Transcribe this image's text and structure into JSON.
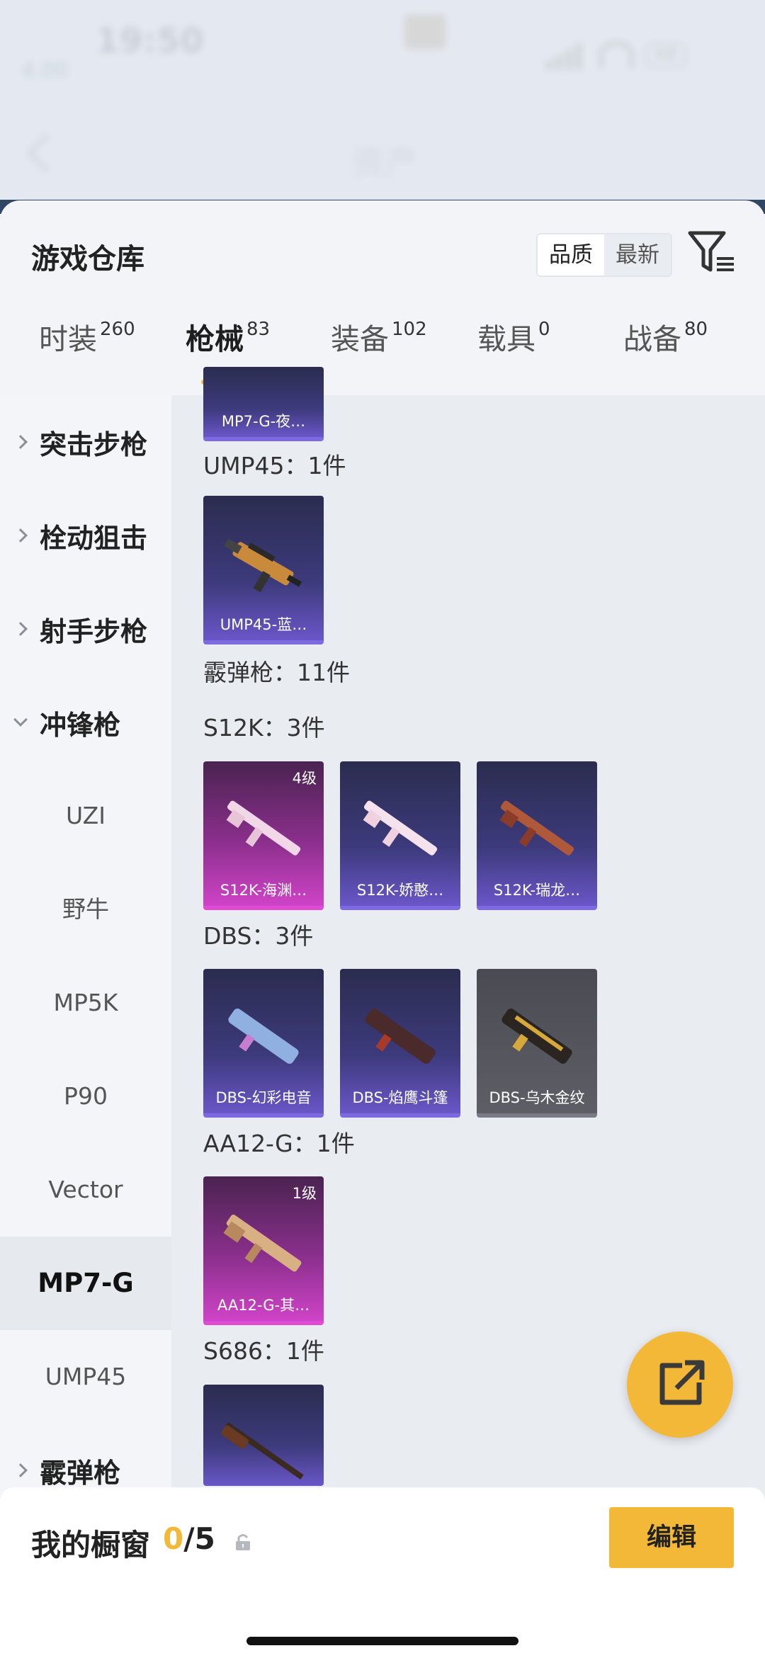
{
  "status": {
    "time": "19:50",
    "sub": "4.00",
    "battery": "68"
  },
  "header": {
    "title": "资产"
  },
  "panel": {
    "title": "游戏仓库",
    "sort": {
      "quality": "品质",
      "latest": "最新"
    }
  },
  "tabs": [
    {
      "label": "时装",
      "count": "260"
    },
    {
      "label": "枪械",
      "count": "83"
    },
    {
      "label": "装备",
      "count": "102"
    },
    {
      "label": "载具",
      "count": "0"
    },
    {
      "label": "战备",
      "count": "80"
    }
  ],
  "sidebar": {
    "categories": [
      "突击步枪",
      "栓动狙击",
      "射手步枪",
      "冲锋枪",
      "霰弹枪"
    ],
    "subs": [
      "UZI",
      "野牛",
      "MP5K",
      "P90",
      "Vector",
      "MP7-G",
      "UMP45"
    ]
  },
  "content": {
    "mp7_card": "MP7-G-夜…",
    "ump45_label": "UMP45：1件",
    "ump45_card": "UMP45-蓝…",
    "shotgun_label": "霰弹枪：11件",
    "s12k_label": "S12K：3件",
    "s12k_cards": [
      "S12K-海渊…",
      "S12K-娇憨…",
      "S12K-瑞龙…"
    ],
    "s12k_level": "4级",
    "dbs_label": "DBS：3件",
    "dbs_cards": [
      "DBS-幻彩电音",
      "DBS-焰鹰斗篷",
      "DBS-乌木金纹"
    ],
    "aa12_label": "AA12-G：1件",
    "aa12_card": "AA12-G-其…",
    "aa12_level": "1级",
    "s686_label": "S686：1件"
  },
  "bottom": {
    "showcase_label": "我的橱窗",
    "showcase_used": "0",
    "showcase_total": "/5",
    "edit": "编辑"
  },
  "colors": {
    "accent": "#f3b838",
    "purple_card": "#3d3a7c",
    "pink_card": "#cf43c7"
  }
}
